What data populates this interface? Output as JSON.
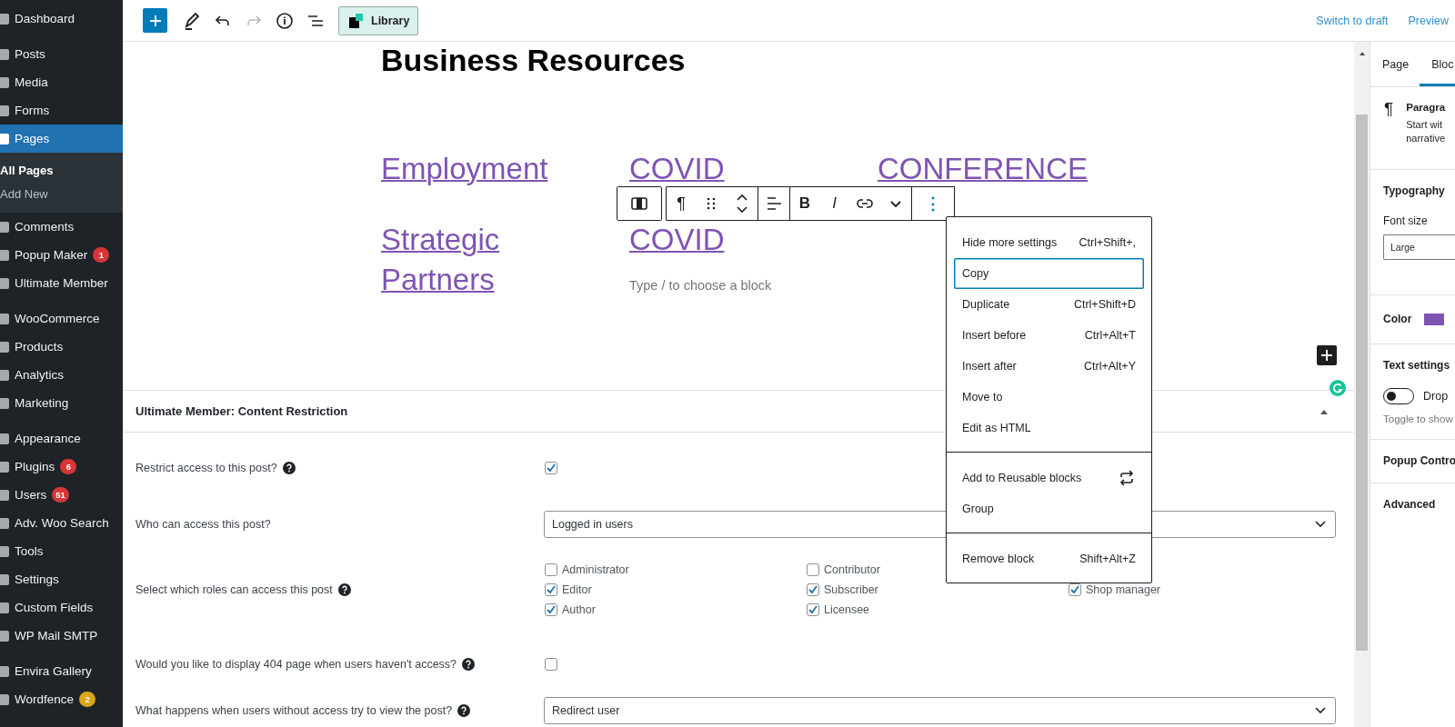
{
  "admin_menu": {
    "groups": [
      {
        "items": [
          {
            "label": "Dashboard",
            "selected": false
          }
        ]
      },
      {
        "items": [
          {
            "label": "Posts",
            "selected": false
          },
          {
            "label": "Media",
            "selected": false
          },
          {
            "label": "Forms",
            "selected": false
          },
          {
            "label": "Pages",
            "selected": true,
            "children": [
              {
                "label": "All Pages",
                "selected": true
              },
              {
                "label": "Add New",
                "selected": false
              }
            ]
          },
          {
            "label": "Comments",
            "selected": false
          },
          {
            "label": "Popup Maker",
            "selected": false,
            "badge": {
              "text": "1",
              "color": "#d63638"
            }
          },
          {
            "label": "Ultimate Member",
            "selected": false
          }
        ]
      },
      {
        "items": [
          {
            "label": "WooCommerce",
            "selected": false
          },
          {
            "label": "Products",
            "selected": false
          },
          {
            "label": "Analytics",
            "selected": false
          },
          {
            "label": "Marketing",
            "selected": false
          }
        ]
      },
      {
        "items": [
          {
            "label": "Appearance",
            "selected": false
          },
          {
            "label": "Plugins",
            "selected": false,
            "badge": {
              "text": "6",
              "color": "#d63638"
            }
          },
          {
            "label": "Users",
            "selected": false,
            "badge": {
              "text": "51",
              "color": "#d63638"
            }
          },
          {
            "label": "Adv. Woo Search",
            "selected": false
          },
          {
            "label": "Tools",
            "selected": false
          },
          {
            "label": "Settings",
            "selected": false
          },
          {
            "label": "Custom Fields",
            "selected": false
          },
          {
            "label": "WP Mail SMTP",
            "selected": false
          }
        ]
      },
      {
        "items": [
          {
            "label": "Envira Gallery",
            "selected": false
          },
          {
            "label": "Wordfence",
            "selected": false,
            "badge": {
              "text": "2",
              "color": "#dba617"
            }
          }
        ]
      }
    ]
  },
  "top_toolbar": {
    "tools": [
      {
        "kind": "inserter",
        "disabled": false
      },
      {
        "kind": "tools",
        "disabled": false
      },
      {
        "kind": "undo",
        "disabled": false
      },
      {
        "kind": "redo",
        "disabled": true
      },
      {
        "kind": "details",
        "disabled": false
      },
      {
        "kind": "list_view",
        "disabled": false
      }
    ],
    "library_button": {
      "label": "Library"
    },
    "actions": [
      {
        "label": "Switch to draft"
      },
      {
        "label": "Preview"
      }
    ]
  },
  "editor": {
    "title": "Business Resources",
    "link_columns": [
      {
        "links": [
          "Employment",
          "Strategic Partners"
        ]
      },
      {
        "links": [
          "COVID",
          "COVID"
        ],
        "placeholder": "Type / to choose a block"
      },
      {
        "links": [
          "CONFERENCE"
        ]
      }
    ],
    "block_toolbar": [
      {
        "kind": "block_type",
        "pressed": false
      },
      {
        "kind": "paragraph",
        "label": "¶",
        "pressed": false
      },
      {
        "kind": "drag",
        "pressed": false
      },
      {
        "kind": "move",
        "pressed": false
      },
      {
        "kind": "align",
        "pressed": false
      },
      {
        "kind": "bold",
        "label": "B",
        "pressed": false
      },
      {
        "kind": "italic",
        "label": "I",
        "pressed": false
      },
      {
        "kind": "link",
        "pressed": false
      },
      {
        "kind": "more",
        "pressed": false
      },
      {
        "kind": "options",
        "label": "⋮",
        "pressed": true
      }
    ]
  },
  "block_menu": {
    "sections": [
      {
        "items": [
          {
            "kind": "text",
            "label": "Hide more settings",
            "shortcut": "Ctrl+Shift+,",
            "selected": false
          },
          {
            "kind": "text",
            "label": "Copy",
            "selected": true
          },
          {
            "kind": "text",
            "label": "Duplicate",
            "shortcut": "Ctrl+Shift+D",
            "selected": false
          },
          {
            "kind": "text",
            "label": "Insert before",
            "shortcut": "Ctrl+Alt+T",
            "selected": false
          },
          {
            "kind": "text",
            "label": "Insert after",
            "shortcut": "Ctrl+Alt+Y",
            "selected": false
          },
          {
            "kind": "text",
            "label": "Move to",
            "selected": false
          },
          {
            "kind": "text",
            "label": "Edit as HTML",
            "selected": false
          }
        ]
      },
      {
        "items": [
          {
            "kind": "with_icon",
            "label": "Add to Reusable blocks",
            "selected": false
          },
          {
            "kind": "text",
            "label": "Group",
            "selected": false
          }
        ]
      },
      {
        "items": [
          {
            "kind": "text",
            "label": "Remove block",
            "shortcut": "Shift+Alt+Z",
            "selected": false
          }
        ]
      }
    ]
  },
  "meta_box": {
    "title": "Ultimate Member: Content Restriction",
    "expanded": true,
    "fields": [
      {
        "kind": "checkbox",
        "label": "Restrict access to this post?",
        "help": true,
        "checked": true
      },
      {
        "kind": "select",
        "label": "Who can access this post?",
        "help": false,
        "value": "Logged in users"
      },
      {
        "kind": "checklist",
        "label": "Select which roles can access this post",
        "help": true,
        "columns": [
          [
            {
              "label": "Administrator",
              "checked": false
            },
            {
              "label": "Editor",
              "checked": true
            },
            {
              "label": "Author",
              "checked": true
            }
          ],
          [
            {
              "label": "Contributor",
              "checked": false
            },
            {
              "label": "Subscriber",
              "checked": true
            },
            {
              "label": "Licensee",
              "checked": true
            }
          ],
          [
            {
              "label": "Shop manager",
              "checked": true
            }
          ]
        ]
      },
      {
        "kind": "checkbox",
        "label": "Would you like to display 404 page when users haven't access?",
        "help": true,
        "checked": false
      },
      {
        "kind": "select",
        "label": "What happens when users without access try to view the post?",
        "help": true,
        "value": "Redirect user"
      }
    ]
  },
  "settings_panel": {
    "tabs": [
      {
        "label": "Page",
        "selected": false
      },
      {
        "label": "Bloc",
        "selected": true
      }
    ],
    "block_card": {
      "icon": "¶",
      "title": "Paragra",
      "description_lines": [
        "Start wit",
        "narrative"
      ]
    },
    "sections": [
      {
        "kind": "font_size",
        "title": "Typography",
        "label": "Font size",
        "value": "Large"
      },
      {
        "kind": "color",
        "title": "Color",
        "color": "#7f54b3"
      },
      {
        "kind": "toggle",
        "title": "Text settings",
        "label": "Drop",
        "on": false,
        "help": "Toggle to show"
      },
      {
        "kind": "collapsed",
        "title": "Popup Contro"
      },
      {
        "kind": "collapsed",
        "title": "Advanced"
      }
    ]
  }
}
